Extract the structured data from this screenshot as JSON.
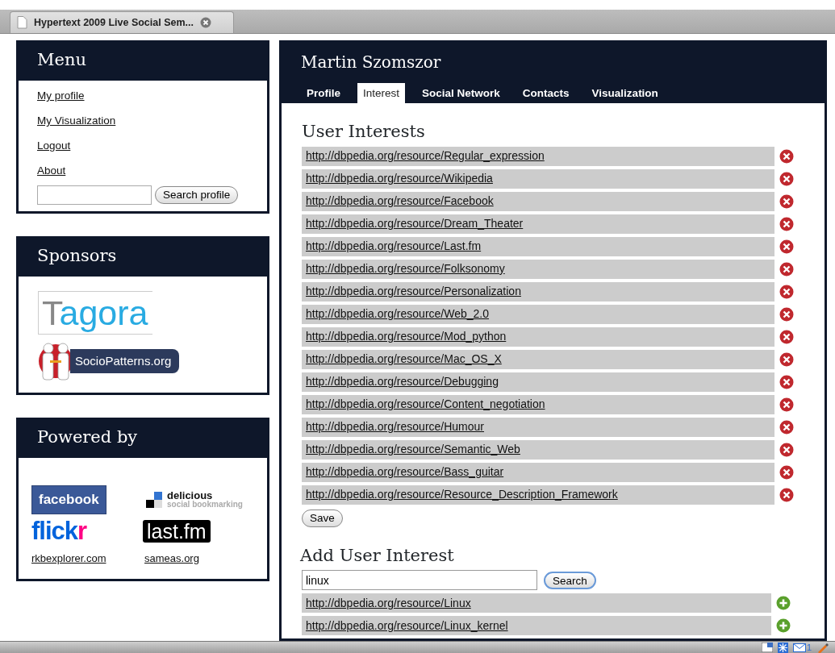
{
  "browser_tab": {
    "title": "Hypertext 2009 Live Social Sem..."
  },
  "menu": {
    "title": "Menu",
    "links": [
      "My profile",
      "My Visualization",
      "Logout",
      "About"
    ],
    "search_button": "Search profile"
  },
  "sponsors": {
    "title": "Sponsors",
    "logos": [
      {
        "kind": "tagora",
        "text": "Tagora"
      },
      {
        "kind": "sociopatterns",
        "text": "SocioPatterns.org"
      }
    ]
  },
  "powered_by": {
    "title": "Powered by",
    "logos": [
      {
        "kind": "facebook",
        "text": "facebook"
      },
      {
        "kind": "delicious",
        "text": "delicious",
        "subtext": "social bookmarking"
      },
      {
        "kind": "flickr",
        "text": "flickr"
      },
      {
        "kind": "lastfm",
        "text": "last.fm"
      }
    ],
    "links": [
      "rkbexplorer.com",
      "sameas.org"
    ]
  },
  "profile": {
    "name": "Martin Szomszor",
    "tabs": [
      {
        "label": "Profile",
        "selected": false
      },
      {
        "label": "Interest",
        "selected": true
      },
      {
        "label": "Social Network",
        "selected": false
      },
      {
        "label": "Contacts",
        "selected": false
      },
      {
        "label": "Visualization",
        "selected": false
      }
    ],
    "interests_title": "User Interests",
    "interests": [
      "http://dbpedia.org/resource/Regular_expression",
      "http://dbpedia.org/resource/Wikipedia",
      "http://dbpedia.org/resource/Facebook",
      "http://dbpedia.org/resource/Dream_Theater",
      "http://dbpedia.org/resource/Last.fm",
      "http://dbpedia.org/resource/Folksonomy",
      "http://dbpedia.org/resource/Personalization",
      "http://dbpedia.org/resource/Web_2.0",
      "http://dbpedia.org/resource/Mod_python",
      "http://dbpedia.org/resource/Mac_OS_X",
      "http://dbpedia.org/resource/Debugging",
      "http://dbpedia.org/resource/Content_negotiation",
      "http://dbpedia.org/resource/Humour",
      "http://dbpedia.org/resource/Semantic_Web",
      "http://dbpedia.org/resource/Bass_guitar",
      "http://dbpedia.org/resource/Resource_Description_Framework"
    ],
    "save_button": "Save",
    "add_title": "Add User Interest",
    "search": {
      "value": "linux",
      "button": "Search"
    },
    "results": [
      "http://dbpedia.org/resource/Linux",
      "http://dbpedia.org/resource/Linux_kernel"
    ]
  },
  "status_bar": {
    "mail_count": "1"
  }
}
